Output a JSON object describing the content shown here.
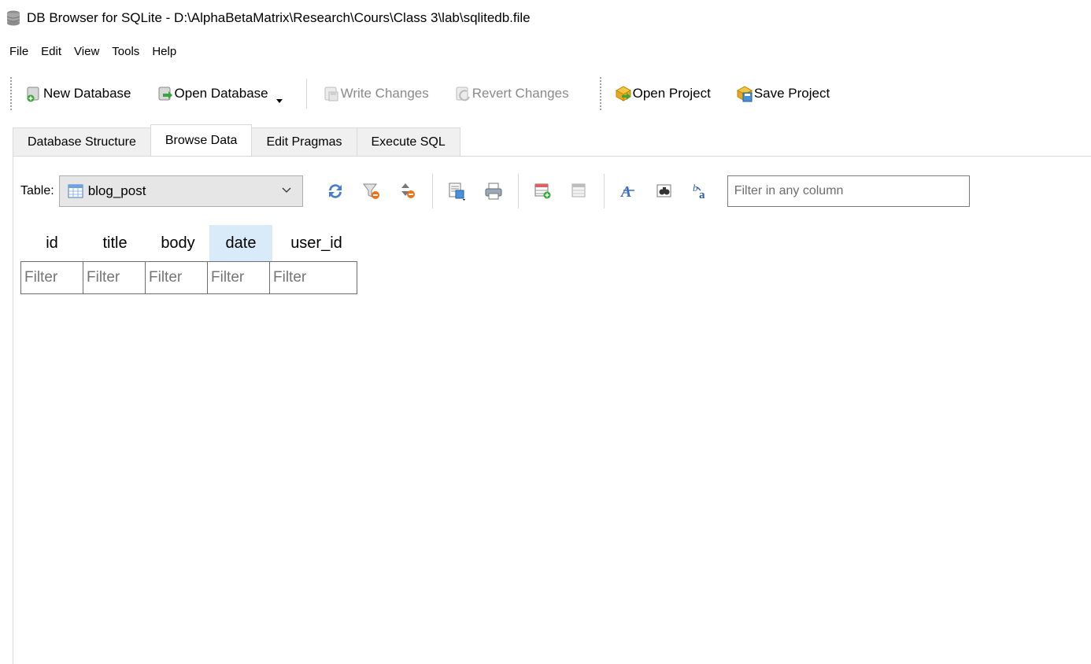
{
  "window": {
    "title": "DB Browser for SQLite - D:\\AlphaBetaMatrix\\Research\\Cours\\Class 3\\lab\\sqlitedb.file",
    "icon": "database-icon"
  },
  "menu": {
    "items": [
      "File",
      "Edit",
      "View",
      "Tools",
      "Help"
    ]
  },
  "toolbar": {
    "new_database": "New Database",
    "open_database": "Open Database",
    "write_changes": "Write Changes",
    "revert_changes": "Revert Changes",
    "open_project": "Open Project",
    "save_project": "Save Project"
  },
  "tabs": {
    "items": [
      "Database Structure",
      "Browse Data",
      "Edit Pragmas",
      "Execute SQL"
    ],
    "active": "Browse Data"
  },
  "browse": {
    "table_label": "Table:",
    "selected_table": "blog_post",
    "filter_placeholder": "Filter in any column"
  },
  "grid": {
    "columns": [
      "id",
      "title",
      "body",
      "date",
      "user_id"
    ],
    "selected_column": "date",
    "filter_placeholder": "Filter"
  },
  "colors": {
    "selected_header": "#d9ebf9",
    "disabled_text": "#8a8a8a",
    "border": "#d9d9d9"
  }
}
